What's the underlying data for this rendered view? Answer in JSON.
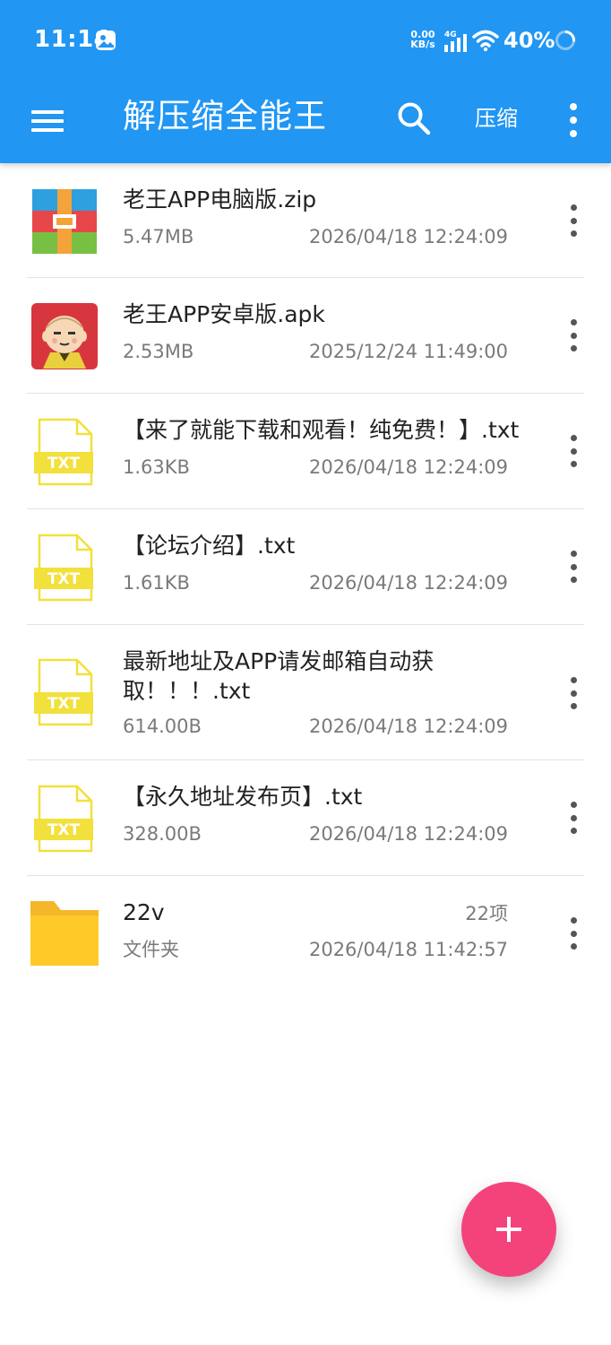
{
  "status_bar": {
    "time": "11:14",
    "net_speed_value": "0.00",
    "net_speed_unit": "KB/s",
    "network_type": "4G",
    "battery": "40%"
  },
  "app_bar": {
    "title": "解压缩全能王",
    "compress_label": "压缩",
    "icons": [
      "menu-icon",
      "search-icon",
      "more-vert-icon"
    ]
  },
  "files": [
    {
      "name": "老王APP电脑版.zip",
      "size": "5.47MB",
      "date": "2026/04/18 12:24:09",
      "type": "zip"
    },
    {
      "name": "老王APP安卓版.apk",
      "size": "2.53MB",
      "date": "2025/12/24 11:49:00",
      "type": "apk"
    },
    {
      "name": "【来了就能下载和观看！纯免费！】.txt",
      "size": "1.63KB",
      "date": "2026/04/18 12:24:09",
      "type": "txt"
    },
    {
      "name": "【论坛介绍】.txt",
      "size": "1.61KB",
      "date": "2026/04/18 12:24:09",
      "type": "txt"
    },
    {
      "name_line1": "最新地址及APP请发邮箱自动获",
      "name_line2": "取！！！.txt",
      "size": "614.00B",
      "date": "2026/04/18 12:24:09",
      "type": "txt"
    },
    {
      "name": "【永久地址发布页】.txt",
      "size": "328.00B",
      "date": "2026/04/18 12:24:09",
      "type": "txt"
    },
    {
      "name": "22v",
      "kind": "文件夹",
      "count": "22项",
      "date": "2026/04/18 11:42:57",
      "type": "folder"
    }
  ],
  "txt_icon_label": "TXT",
  "colors": {
    "primary": "#2196f3",
    "fab": "#f4437b",
    "txt_yellow": "#f2e03c",
    "folder_yellow": "#ffca28"
  }
}
